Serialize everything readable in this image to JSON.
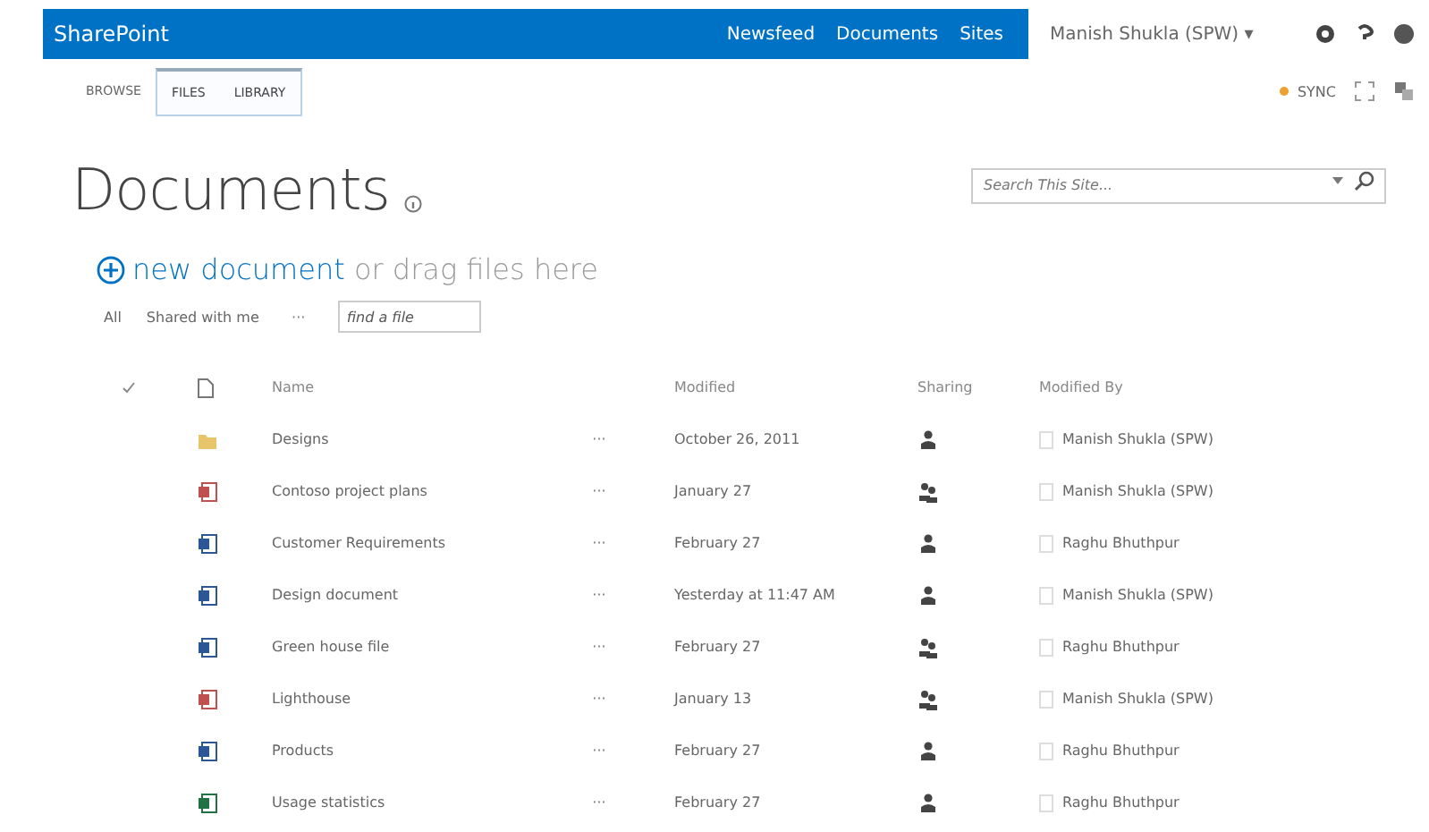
{
  "suite_bar": {
    "brand": "SharePoint",
    "links": [
      "Newsfeed",
      "Documents",
      "Sites"
    ],
    "user": "Manish Shukla (SPW) ▾"
  },
  "ribbon": {
    "tabs": [
      {
        "label": "BROWSE",
        "selected": false
      },
      {
        "label": "FILES",
        "selected": true
      },
      {
        "label": "LIBRARY",
        "selected": true
      }
    ],
    "sync": "SYNC"
  },
  "page": {
    "title": "Documents",
    "search": {
      "placeholder": "Search This Site..."
    }
  },
  "new_document": {
    "link": "new document",
    "rest": " or drag files here"
  },
  "views": {
    "items": [
      "All",
      "Shared with me"
    ],
    "more": "···",
    "find": {
      "placeholder": "find a file"
    }
  },
  "table": {
    "columns": [
      "Name",
      "Modified",
      "Sharing",
      "Modified By"
    ],
    "rows": [
      {
        "kind": "folder",
        "name": "Designs",
        "menu": "···",
        "modified": "October 26, 2011",
        "shared": false,
        "modified_by": "Manish Shukla (SPW)"
      },
      {
        "kind": "powerpoint",
        "name": "Contoso project plans",
        "menu": "···",
        "modified": "January 27",
        "shared": true,
        "modified_by": "Manish Shukla (SPW)"
      },
      {
        "kind": "word",
        "name": "Customer Requirements",
        "menu": "···",
        "modified": "February 27",
        "shared": false,
        "modified_by": "Raghu Bhuthpur"
      },
      {
        "kind": "word",
        "name": "Design document",
        "menu": "···",
        "modified": "Yesterday at 11:47 AM",
        "shared": false,
        "modified_by": "Manish Shukla (SPW)"
      },
      {
        "kind": "word",
        "name": "Green house file",
        "menu": "···",
        "modified": "February 27",
        "shared": true,
        "modified_by": "Raghu Bhuthpur"
      },
      {
        "kind": "powerpoint",
        "name": "Lighthouse",
        "menu": "···",
        "modified": "January 13",
        "shared": true,
        "modified_by": "Manish Shukla (SPW)"
      },
      {
        "kind": "word",
        "name": "Products",
        "menu": "···",
        "modified": "February 27",
        "shared": false,
        "modified_by": "Raghu Bhuthpur"
      },
      {
        "kind": "excel",
        "name": "Usage statistics",
        "menu": "···",
        "modified": "February 27",
        "shared": false,
        "modified_by": "Raghu Bhuthpur"
      }
    ]
  }
}
